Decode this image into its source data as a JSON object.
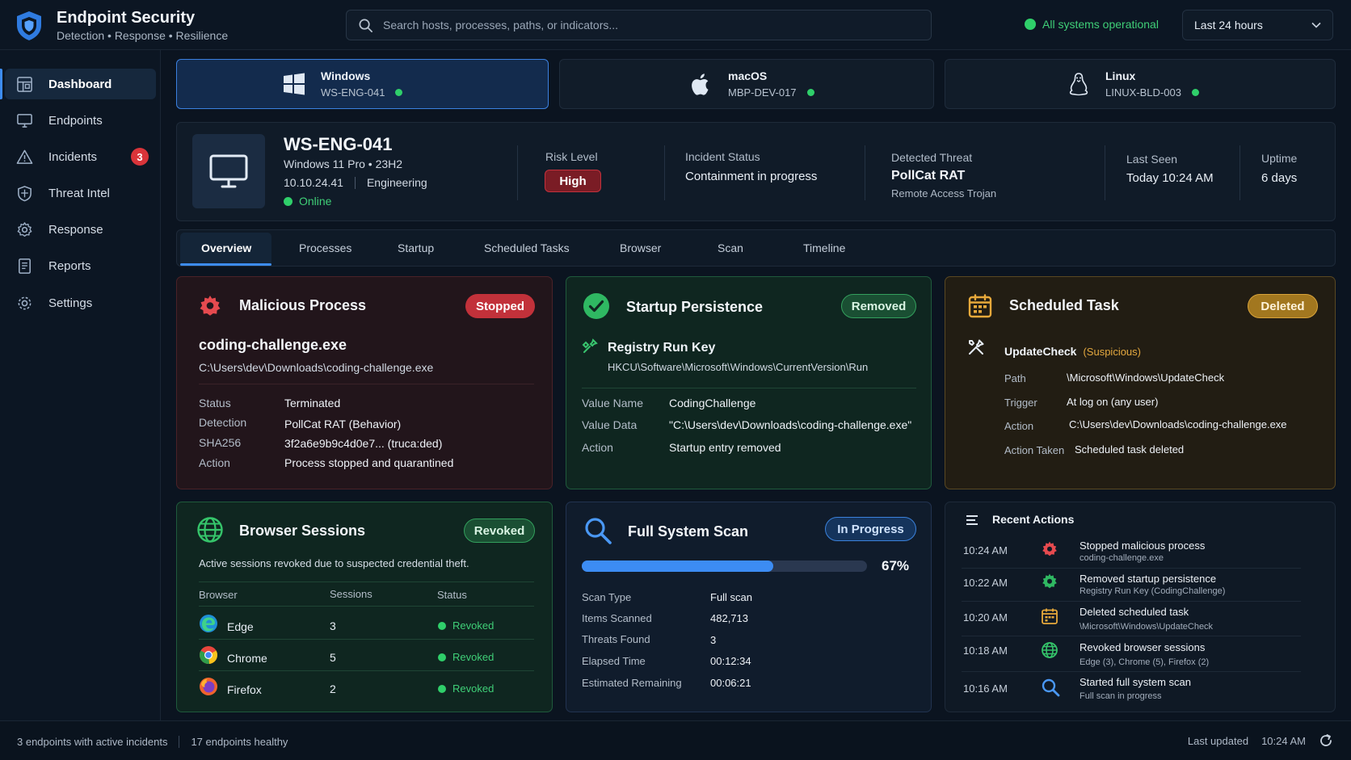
{
  "app": {
    "title": "Endpoint Security",
    "subtitle": "Detection • Response • Resilience",
    "search_placeholder": "Search hosts, processes, paths, or indicators...",
    "system_status": "All systems operational",
    "time_range": "Last 24 hours"
  },
  "sidebar": {
    "items": [
      {
        "label": "Dashboard",
        "icon": "dashboard-icon",
        "active": true
      },
      {
        "label": "Endpoints",
        "icon": "monitor-icon"
      },
      {
        "label": "Incidents",
        "icon": "warning-icon",
        "badge": "3"
      },
      {
        "label": "Threat Intel",
        "icon": "shield-icon"
      },
      {
        "label": "Response",
        "icon": "gear-icon"
      },
      {
        "label": "Reports",
        "icon": "document-icon"
      },
      {
        "label": "Settings",
        "icon": "settings-icon"
      }
    ]
  },
  "endpoints": [
    {
      "os": "Windows",
      "host": "WS-ENG-041",
      "active": true,
      "icon": "windows-icon"
    },
    {
      "os": "macOS",
      "host": "MBP-DEV-017",
      "icon": "apple-icon"
    },
    {
      "os": "Linux",
      "host": "LINUX-BLD-003",
      "icon": "linux-icon"
    }
  ],
  "host": {
    "name": "WS-ENG-041",
    "os": "Windows 11 Pro • 23H2",
    "ip": "10.10.24.41",
    "department": "Engineering",
    "status": "Online",
    "risk_label": "Risk Level",
    "risk": "High",
    "incident_label": "Incident Status",
    "incident": "Containment in progress",
    "threat_label": "Detected Threat",
    "threat": "PollCat RAT",
    "threat_type": "Remote Access Trojan",
    "last_seen_label": "Last Seen",
    "last_seen": "Today 10:24 AM",
    "uptime_label": "Uptime",
    "uptime": "6 days"
  },
  "tabs": [
    "Overview",
    "Processes",
    "Startup",
    "Scheduled Tasks",
    "Browser",
    "Scan",
    "Timeline"
  ],
  "malicious_process": {
    "title": "Malicious Process",
    "badge": "Stopped",
    "name": "coding-challenge.exe",
    "path": "C:\\Users\\dev\\Downloads\\coding-challenge.exe",
    "rows": [
      {
        "k": "Status",
        "v": "Terminated"
      },
      {
        "k": "Detection",
        "v": "PollCat RAT (Behavior)"
      },
      {
        "k": "SHA256",
        "v": "3f2a6e9b9c4d0e7... (truca:ded)"
      },
      {
        "k": "Action",
        "v": "Process stopped and quarantined"
      }
    ]
  },
  "startup": {
    "title": "Startup Persistence",
    "badge": "Removed",
    "entry": "Registry Run Key",
    "key": "HKCU\\Software\\Microsoft\\Windows\\CurrentVersion\\Run",
    "rows": [
      {
        "k": "Value Name",
        "v": "CodingChallenge"
      },
      {
        "k": "Value Data",
        "v": "\"C:\\Users\\dev\\Downloads\\coding-challenge.exe\""
      },
      {
        "k": "Action",
        "v": "Startup entry removed"
      }
    ]
  },
  "scheduled_task": {
    "title": "Scheduled Task",
    "badge": "Deleted",
    "name": "UpdateCheck",
    "flag": "(Suspicious)",
    "rows": [
      {
        "k": "Path",
        "v": "\\Microsoft\\Windows\\UpdateCheck"
      },
      {
        "k": "Trigger",
        "v": "At log on (any user)"
      },
      {
        "k": "Action",
        "v": "C:\\Users\\dev\\Downloads\\coding-challenge.exe"
      },
      {
        "k": "Action Taken",
        "v": "Scheduled task deleted"
      }
    ]
  },
  "browser_sessions": {
    "title": "Browser Sessions",
    "badge": "Revoked",
    "note": "Active sessions revoked due to suspected credential theft.",
    "headers": [
      "Browser",
      "Sessions",
      "Status"
    ],
    "rows": [
      {
        "browser": "Edge",
        "sessions": "3",
        "status": "Revoked",
        "icon": "edge-icon"
      },
      {
        "browser": "Chrome",
        "sessions": "5",
        "status": "Revoked",
        "icon": "chrome-icon"
      },
      {
        "browser": "Firefox",
        "sessions": "2",
        "status": "Revoked",
        "icon": "firefox-icon"
      }
    ]
  },
  "scan": {
    "title": "Full System Scan",
    "badge": "In Progress",
    "progress": 0.67,
    "progress_label": "67%",
    "rows": [
      {
        "k": "Scan Type",
        "v": "Full scan"
      },
      {
        "k": "Items Scanned",
        "v": "482,713"
      },
      {
        "k": "Threats Found",
        "v": "3"
      },
      {
        "k": "Elapsed Time",
        "v": "00:12:34"
      },
      {
        "k": "Estimated Remaining",
        "v": "00:06:21"
      }
    ]
  },
  "recent_actions": {
    "title": "Recent Actions",
    "items": [
      {
        "time": "10:24 AM",
        "title": "Stopped malicious process",
        "sub": "coding-challenge.exe",
        "icon": "gear-icon"
      },
      {
        "time": "10:22 AM",
        "title": "Removed startup persistence",
        "sub": "Registry Run Key (CodingChallenge)",
        "icon": "gear-icon"
      },
      {
        "time": "10:20 AM",
        "title": "Deleted scheduled task",
        "sub": "\\Microsoft\\Windows\\UpdateCheck",
        "icon": "calendar-icon"
      },
      {
        "time": "10:18 AM",
        "title": "Revoked browser sessions",
        "sub": "Edge (3), Chrome (5), Firefox (2)",
        "icon": "globe-icon"
      },
      {
        "time": "10:16 AM",
        "title": "Started full system scan",
        "sub": "Full scan in progress",
        "icon": "search-icon"
      }
    ]
  },
  "footer": {
    "incidents": "3 endpoints with active incidents",
    "healthy": "17 endpoints healthy",
    "last_updated_label": "Last updated",
    "last_updated": "10:24 AM"
  },
  "colors": {
    "accent": "#3d8cf0",
    "danger": "#c2313a",
    "success": "#2fcf6a",
    "warning": "#d8a33a"
  }
}
